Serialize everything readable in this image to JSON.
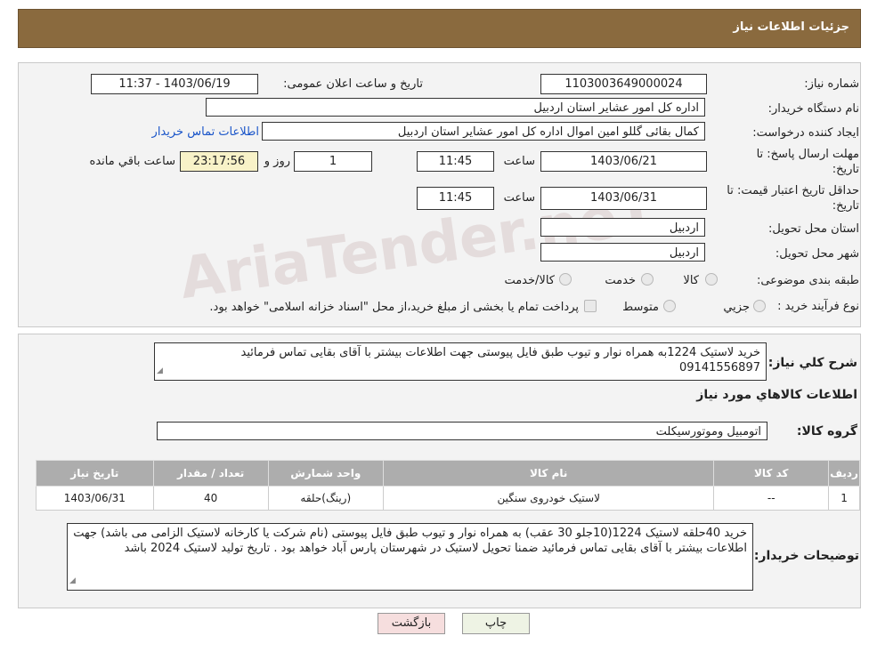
{
  "header": {
    "title": "جزئیات اطلاعات نیاز"
  },
  "watermark": "AriaTender.neT",
  "form": {
    "need_number": {
      "label": "شماره نیاز:",
      "value": "1103003649000024"
    },
    "announce_datetime": {
      "label": "تاریخ و ساعت اعلان عمومی:",
      "value": "1403/06/19 - 11:37"
    },
    "buyer_org": {
      "label": "نام دستگاه خریدار:",
      "value": "اداره کل امور عشایر استان اردبیل"
    },
    "requester": {
      "label": "ایجاد کننده درخواست:",
      "value": "کمال بقائی گللو امین اموال اداره کل امور عشایر استان اردبیل",
      "contact_link": "اطلاعات تماس خریدار"
    },
    "reply_deadline": {
      "label": "مهلت ارسال پاسخ: تا تاریخ:",
      "date": "1403/06/21",
      "time_label": "ساعت",
      "time": "11:45",
      "days": "1",
      "days_label": "روز و",
      "remaining": "23:17:56",
      "remaining_label": "ساعت باقي مانده"
    },
    "price_validity": {
      "label": "حداقل تاریخ اعتبار قیمت: تا تاریخ:",
      "date": "1403/06/31",
      "time_label": "ساعت",
      "time": "11:45"
    },
    "delivery_province": {
      "label": "استان محل تحویل:",
      "value": "اردبیل"
    },
    "delivery_city": {
      "label": "شهر محل تحویل:",
      "value": "اردبیل"
    },
    "category": {
      "label": "طبقه بندی موضوعی:",
      "options": [
        "کالا",
        "خدمت",
        "کالا/خدمت"
      ]
    },
    "purchase_type": {
      "label": "نوع فرآیند خرید :",
      "options": [
        "جزیي",
        "متوسط"
      ],
      "note": "پرداخت تمام یا بخشی از مبلغ خرید،از محل \"اسناد خزانه اسلامی\" خواهد بود."
    }
  },
  "summary": {
    "label": "شرح کلي نياز:",
    "text": "خرید لاستیک 1224به همراه نوار و تیوب طبق فایل پیوستی جهت اطلاعات بیشتر با آقای بقایی تماس فرمائید 09141556897",
    "items_title": "اطلاعات کالاهاي مورد نياز",
    "group_label": "گروه کالا:",
    "group_value": "اتومبیل وموتورسیکلت",
    "columns": [
      "ردیف",
      "کد کالا",
      "نام کالا",
      "واحد شمارش",
      "تعداد / مقدار",
      "تاریخ نیاز"
    ],
    "rows": [
      [
        "1",
        "--",
        "لاستیک خودروی سنگین",
        "(رینگ)حلقه",
        "40",
        "1403/06/31"
      ]
    ],
    "buyer_notes_label": "توضیحات خریدار:",
    "buyer_notes": "خرید 40حلقه لاستیک 1224(10جلو 30 عقب) به همراه نوار و تیوب طبق فایل پیوستی (نام شرکت یا کارخانه لاستیک الزامی می باشد) جهت اطلاعات بیشتر با آقای بقایی تماس فرمائید ضمنا تحویل لاستیک در شهرستان پارس آباد خواهد بود . تاریخ تولید لاستیک 2024 باشد"
  },
  "buttons": {
    "print": "چاپ",
    "back": "بازگشت"
  }
}
